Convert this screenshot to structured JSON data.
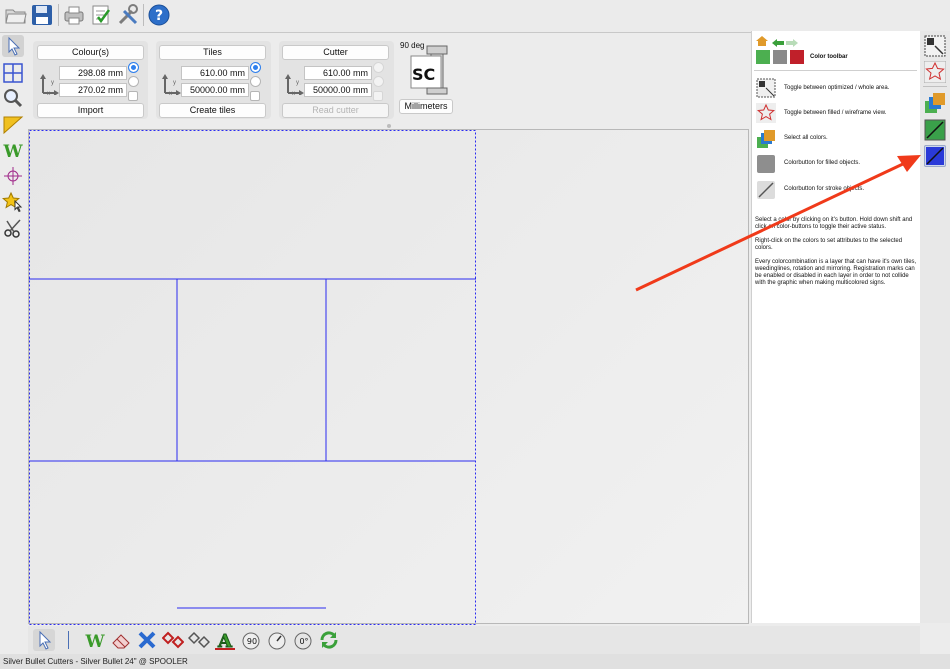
{
  "panels": {
    "colours": {
      "title": "Colour(s)",
      "width_value": "298.08 mm",
      "height_value": "270.02 mm",
      "action": "Import"
    },
    "tiles": {
      "title": "Tiles",
      "width_value": "610.00 mm",
      "height_value": "50000.00 mm",
      "action": "Create tiles"
    },
    "cutter": {
      "title": "Cutter",
      "width_value": "610.00 mm",
      "height_value": "50000.00 mm",
      "action": "Read cutter"
    },
    "rotation_label": "90 deg",
    "logo_text": "SC",
    "units_label": "Millimeters"
  },
  "right_panel": {
    "toolbar_title": "Color toolbar",
    "items": [
      {
        "icon": "optimize-area-icon",
        "text": "Toggle between optimized / whole area."
      },
      {
        "icon": "star-wireframe-icon",
        "text": "Toggle between filled / wireframe view."
      },
      {
        "icon": "select-all-colors-icon",
        "text": "Select all colors."
      },
      {
        "icon": "filled-color-icon",
        "text": "Colorbutton for filled objects."
      },
      {
        "icon": "stroke-color-icon",
        "text": "Colorbutton for stroke objects."
      }
    ],
    "help": [
      "Select a color by clicking on it's button. Hold down shift and click on color-buttons to toggle their active status.",
      "Right-click on the colors to set attributes to the selected colors.",
      "Every colorcombination is a layer that can have it's own tiles, weedinglines, rotation and mirroring. Registration marks can be enabled or disabled in each layer in order to not collide with the graphic when making multicolored signs."
    ]
  },
  "bottom": {
    "rotation_90": "90",
    "rotation_0": "0°"
  },
  "status": "Silver Bullet Cutters - Silver Bullet 24\" @ SPOOLER",
  "colors": {
    "accent_blue": "#2f80ed",
    "tile_line": "#2a2af0",
    "arrow": "#f03a1a"
  }
}
